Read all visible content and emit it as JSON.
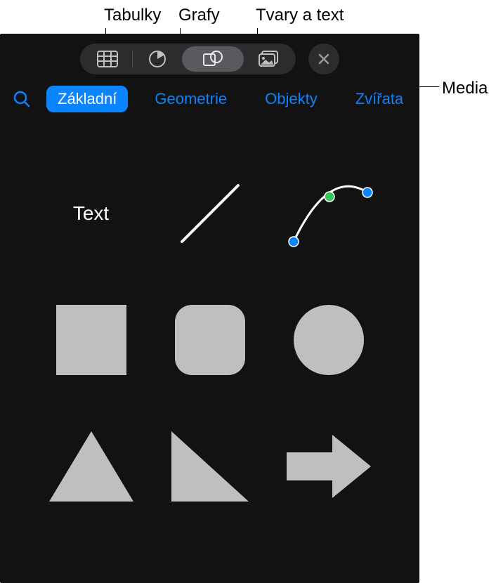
{
  "callouts": {
    "tables": "Tabulky",
    "charts": "Grafy",
    "shapes_text": "Tvary a text",
    "media": "Media"
  },
  "toolbar": {
    "tables_icon": "table-icon",
    "charts_icon": "pie-chart-icon",
    "shapes_icon": "shapes-icon",
    "media_icon": "media-icon",
    "close_icon": "close-icon"
  },
  "categories": {
    "search_icon": "search-icon",
    "tabs": [
      {
        "label": "Základní",
        "active": true
      },
      {
        "label": "Geometrie",
        "active": false
      },
      {
        "label": "Objekty",
        "active": false
      },
      {
        "label": "Zvířata",
        "active": false
      }
    ]
  },
  "shapes": {
    "text_label": "Text",
    "items": [
      "text",
      "line",
      "curve",
      "square",
      "rounded-square",
      "circle",
      "triangle",
      "right-triangle",
      "arrow-right"
    ]
  },
  "colors": {
    "shape_fill": "#bfbfbf",
    "accent": "#0a84ff",
    "handle_green": "#34c759",
    "panel_bg": "#121212"
  }
}
